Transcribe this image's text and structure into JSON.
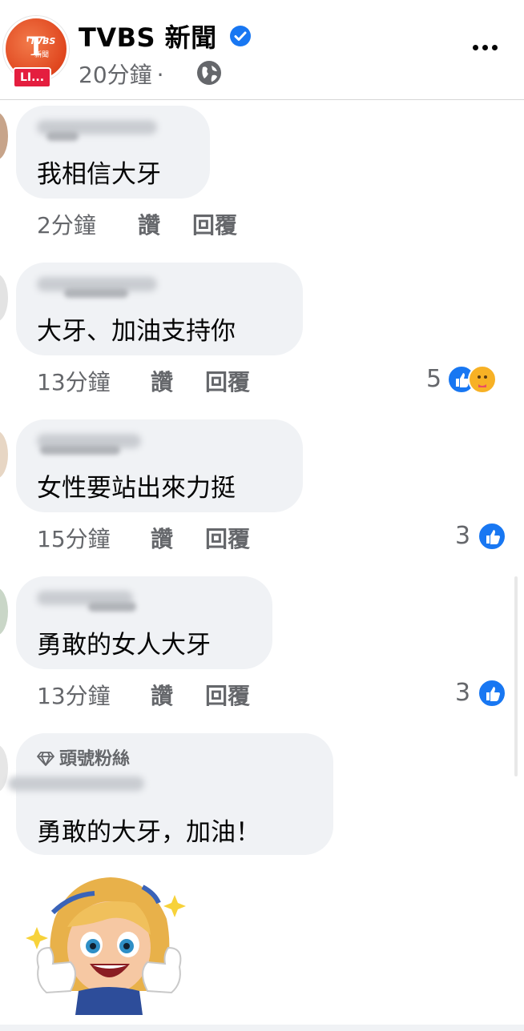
{
  "post": {
    "page_name": "TVBS 新聞",
    "time": "20分鐘",
    "separator": "·",
    "avatar_brand": "TVBS",
    "avatar_cn": "新聞",
    "live_label": "LI..."
  },
  "comments": [
    {
      "text": "我相信大牙",
      "time": "2分鐘",
      "like_label": "讚",
      "reply_label": "回覆",
      "reaction_count": "",
      "reactions": []
    },
    {
      "text": "大牙、加油支持你",
      "time": "13分鐘",
      "like_label": "讚",
      "reply_label": "回覆",
      "reaction_count": "5",
      "reactions": [
        "like-icon",
        "care-icon"
      ]
    },
    {
      "text": "女性要站出來力挺",
      "time": "15分鐘",
      "like_label": "讚",
      "reply_label": "回覆",
      "reaction_count": "3",
      "reactions": [
        "like-icon"
      ]
    },
    {
      "text": "勇敢的女人大牙",
      "time": "13分鐘",
      "like_label": "讚",
      "reply_label": "回覆",
      "reaction_count": "3",
      "reactions": [
        "like-icon"
      ]
    },
    {
      "text": "勇敢的大牙，加油！",
      "badge": "頭號粉絲",
      "time": "",
      "like_label": "",
      "reply_label": "",
      "reaction_count": "",
      "reactions": []
    }
  ],
  "colors": {
    "brand_orange": "#e0471f",
    "facebook_blue": "#1877f2",
    "bubble_gray": "#f0f2f5",
    "meta_gray": "#65676b",
    "live_red": "#e41e3f"
  },
  "icons": [
    "verified-icon",
    "globe-icon",
    "more-icon",
    "diamond-icon",
    "like-icon",
    "care-icon",
    "thumbs-up-sticker"
  ]
}
